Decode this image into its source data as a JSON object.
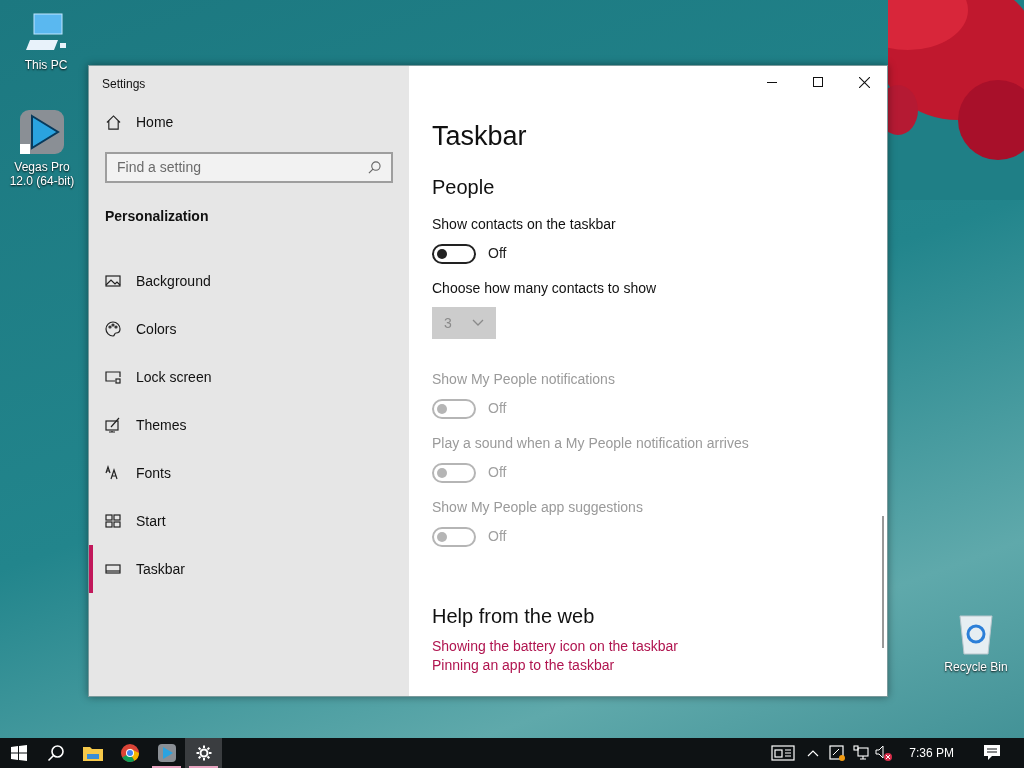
{
  "desktop_icons": [
    {
      "label": "This PC",
      "kind": "computer"
    },
    {
      "label": "Vegas Pro 12.0 (64-bit)",
      "kind": "vegas"
    },
    {
      "label": "Recycle Bin",
      "kind": "recycle"
    }
  ],
  "window": {
    "title": "Settings"
  },
  "sidebar": {
    "home": "Home",
    "search": {
      "placeholder": "Find a setting"
    },
    "section": "Personalization",
    "items": [
      {
        "label": "Background",
        "kind": "background",
        "selected": false
      },
      {
        "label": "Colors",
        "kind": "colors",
        "selected": false
      },
      {
        "label": "Lock screen",
        "kind": "lock",
        "selected": false
      },
      {
        "label": "Themes",
        "kind": "themes",
        "selected": false
      },
      {
        "label": "Fonts",
        "kind": "fonts",
        "selected": false
      },
      {
        "label": "Start",
        "kind": "start",
        "selected": false
      },
      {
        "label": "Taskbar",
        "kind": "taskbar",
        "selected": true
      }
    ]
  },
  "content": {
    "title": "Taskbar",
    "section": "People",
    "settings": [
      {
        "kind": "toggle",
        "label": "Show contacts on the taskbar",
        "on": false,
        "state": "Off",
        "disabled": false
      },
      {
        "kind": "dropdown",
        "label": "Choose how many contacts to show",
        "value": "3",
        "disabled": true
      },
      {
        "kind": "toggle",
        "label": "Show My People notifications",
        "on": false,
        "state": "Off",
        "disabled": true
      },
      {
        "kind": "toggle",
        "label": "Play a sound when a My People notification arrives",
        "on": false,
        "state": "Off",
        "disabled": true
      },
      {
        "kind": "toggle",
        "label": "Show My People app suggestions",
        "on": false,
        "state": "Off",
        "disabled": true
      }
    ],
    "help": {
      "title": "Help from the web",
      "links": [
        "Showing the battery icon on the taskbar",
        "Pinning an app to the taskbar"
      ]
    }
  },
  "taskbar": {
    "apps": [
      {
        "kind": "start",
        "active": false,
        "running": false
      },
      {
        "kind": "search",
        "active": false,
        "running": false
      },
      {
        "kind": "folder",
        "active": false,
        "running": false
      },
      {
        "kind": "chrome",
        "active": false,
        "running": false
      },
      {
        "kind": "vegas",
        "active": false,
        "running": true
      },
      {
        "kind": "settings",
        "active": true,
        "running": true
      }
    ],
    "time": "7:36 PM"
  }
}
